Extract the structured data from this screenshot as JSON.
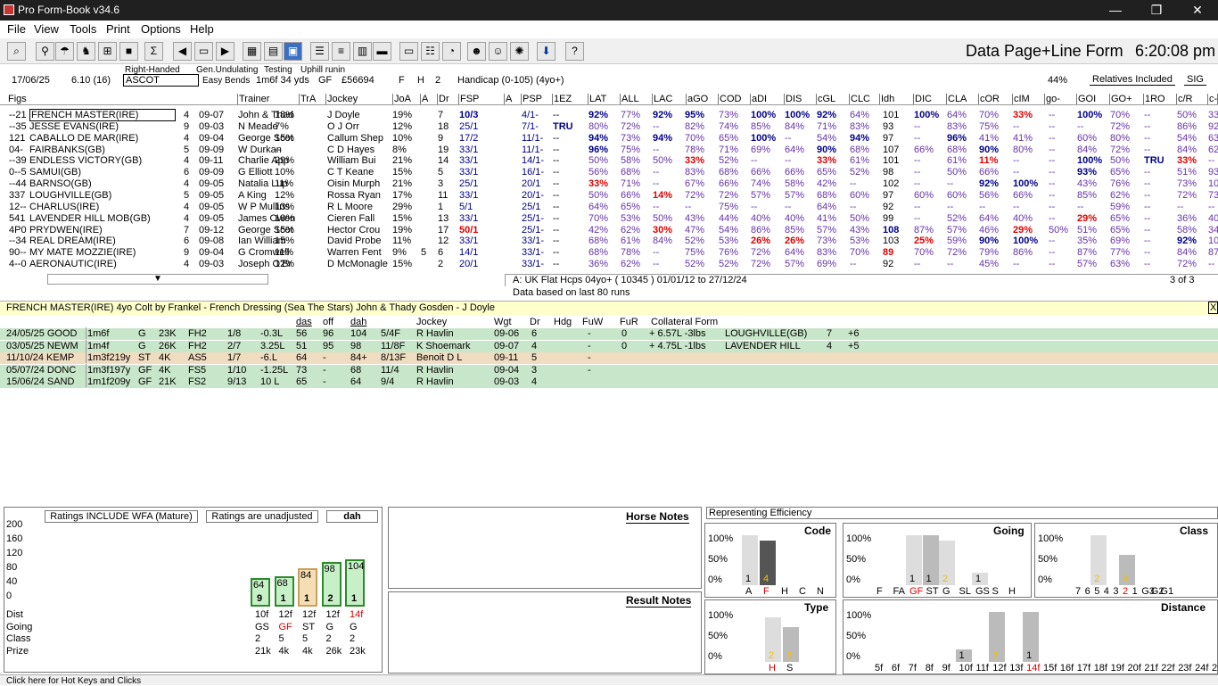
{
  "window": {
    "title": "Pro Form-Book v34.6",
    "min": "—",
    "max": "❐",
    "close": "✕"
  },
  "menu": [
    "File",
    "View",
    "Tools",
    "Print",
    "Options",
    "Help"
  ],
  "page_title": "Data Page+Line Form",
  "clock": "6:20:08 pm",
  "race": {
    "date": "17/06/25",
    "time": "6.10 (16)",
    "course": "ASCOT",
    "hand": "Right-Handed",
    "terrain1": "Gen.Undulating",
    "terrain2": "Easy Bends",
    "testing": "Testing",
    "uphill": "Uphill runin",
    "dist": "1m6f 34 yds",
    "going": "GF",
    "prize": "£56694",
    "f": "F",
    "h": "H",
    "n": "2",
    "type": "Handicap (0-105) (4yo+)",
    "pct": "44%",
    "relatives": "Relatives Included",
    "sig": "SIG"
  },
  "grid_headers": [
    "Figs",
    "Trainer",
    "TrA",
    "Jockey",
    "JoA",
    "A",
    "Dr",
    "FSP",
    "A",
    "PSP",
    "1EZ",
    "LAT",
    "ALL",
    "LAC",
    "aGO",
    "COD",
    "aDI",
    "DIS",
    "cGL",
    "CLC",
    "Idh",
    "DIC",
    "CLA",
    "cOR",
    "cIM",
    "go-",
    "GOI",
    "GO+",
    "1RO",
    "c/R",
    "c-"
  ],
  "runners": [
    [
      "--21",
      "FRENCH MASTER(IRE)",
      "4",
      "09-07",
      "John & Thad",
      "18%",
      "J Doyle",
      "19%",
      "",
      "7",
      "10/3",
      "4/1-",
      "--",
      "92%",
      "77%",
      "92%",
      "95%",
      "73%",
      "100%",
      "100%",
      "92%",
      "64%",
      "101",
      "100%",
      "64%",
      "70%",
      "33%",
      "--",
      "100%",
      "70%",
      "--",
      "50%",
      "33"
    ],
    [
      "--35",
      "JESSE EVANS(IRE)",
      "9",
      "09-03",
      "N Meade",
      "7%",
      "O J Orr",
      "12%",
      "",
      "18",
      "25/1",
      "7/1-",
      "TRU",
      "80%",
      "72%",
      "--",
      "82%",
      "74%",
      "85%",
      "84%",
      "71%",
      "83%",
      "93",
      "--",
      "83%",
      "75%",
      "--",
      "--",
      "--",
      "72%",
      "--",
      "86%",
      "92"
    ],
    [
      "121",
      "CABALLO DE MAR(IRE)",
      "4",
      "09-04",
      "George Scot",
      "15%",
      "Callum Shep",
      "10%",
      "",
      "9",
      "17/2",
      "11/1-",
      "--",
      "94%",
      "73%",
      "94%",
      "70%",
      "65%",
      "100%",
      "--",
      "54%",
      "94%",
      "97",
      "--",
      "96%",
      "41%",
      "41%",
      "--",
      "60%",
      "80%",
      "--",
      "54%",
      "63"
    ],
    [
      "04-",
      "FAIRBANKS(GB)",
      "5",
      "09-09",
      "W Durkan",
      "--",
      "C D Hayes",
      "8%",
      "",
      "19",
      "33/1",
      "11/1-",
      "--",
      "96%",
      "75%",
      "--",
      "78%",
      "71%",
      "69%",
      "64%",
      "90%",
      "68%",
      "107",
      "66%",
      "68%",
      "90%",
      "80%",
      "--",
      "84%",
      "72%",
      "--",
      "84%",
      "62"
    ],
    [
      "--39",
      "ENDLESS VICTORY(GB)",
      "4",
      "09-11",
      "Charlie App",
      "29%",
      "William Bui",
      "21%",
      "",
      "14",
      "33/1",
      "14/1-",
      "--",
      "50%",
      "58%",
      "50%",
      "33%",
      "52%",
      "--",
      "--",
      "33%",
      "61%",
      "101",
      "--",
      "61%",
      "11%",
      "--",
      "--",
      "100%",
      "50%",
      "TRU",
      "33%",
      "--"
    ],
    [
      "0--5",
      "SAMUI(GB)",
      "6",
      "09-09",
      "G Elliott",
      "10%",
      "C T Keane",
      "15%",
      "",
      "5",
      "33/1",
      "16/1-",
      "--",
      "56%",
      "68%",
      "--",
      "83%",
      "68%",
      "66%",
      "66%",
      "65%",
      "52%",
      "98",
      "--",
      "50%",
      "66%",
      "--",
      "--",
      "93%",
      "65%",
      "--",
      "51%",
      "93"
    ],
    [
      "--44",
      "BARNSO(GB)",
      "4",
      "09-05",
      "Natalia Lup",
      "11%",
      "Oisin Murph",
      "21%",
      "",
      "3",
      "25/1",
      "20/1",
      "--",
      "33%",
      "71%",
      "--",
      "67%",
      "66%",
      "74%",
      "58%",
      "42%",
      "--",
      "102",
      "--",
      "--",
      "92%",
      "100%",
      "--",
      "43%",
      "76%",
      "--",
      "73%",
      "10"
    ],
    [
      "337",
      "LOUGHVILLE(GB)",
      "5",
      "09-05",
      "A King",
      "12%",
      "Rossa Ryan",
      "17%",
      "",
      "11",
      "33/1",
      "20/1-",
      "--",
      "50%",
      "66%",
      "14%",
      "72%",
      "72%",
      "57%",
      "57%",
      "68%",
      "60%",
      "97",
      "60%",
      "60%",
      "56%",
      "66%",
      "--",
      "85%",
      "62%",
      "--",
      "72%",
      "73"
    ],
    [
      "12--",
      "CHARLUS(IRE)",
      "4",
      "09-05",
      "W P Mullins",
      "13%",
      "R L Moore",
      "29%",
      "",
      "1",
      "5/1",
      "25/1",
      "--",
      "64%",
      "65%",
      "--",
      "--",
      "75%",
      "--",
      "--",
      "64%",
      "--",
      "92",
      "--",
      "--",
      "--",
      "--",
      "--",
      "--",
      "59%",
      "--",
      "--",
      "--"
    ],
    [
      "541",
      "LAVENDER HILL MOB(GB)",
      "4",
      "09-05",
      "James Owen",
      "18%",
      "Cieren Fall",
      "15%",
      "",
      "13",
      "33/1",
      "25/1-",
      "--",
      "70%",
      "53%",
      "50%",
      "43%",
      "44%",
      "40%",
      "40%",
      "41%",
      "50%",
      "99",
      "--",
      "52%",
      "64%",
      "40%",
      "--",
      "29%",
      "65%",
      "--",
      "36%",
      "40"
    ],
    [
      "4P0",
      "PRYDWEN(IRE)",
      "7",
      "09-12",
      "George Scot",
      "15%",
      "Hector Crou",
      "19%",
      "",
      "17",
      "50/1",
      "25/1-",
      "--",
      "42%",
      "62%",
      "30%",
      "47%",
      "54%",
      "86%",
      "85%",
      "57%",
      "43%",
      "108",
      "87%",
      "57%",
      "46%",
      "29%",
      "50%",
      "51%",
      "65%",
      "--",
      "58%",
      "34"
    ],
    [
      "--34",
      "REAL DREAM(IRE)",
      "6",
      "09-08",
      "Ian William",
      "15%",
      "David Probe",
      "11%",
      "",
      "12",
      "33/1",
      "33/1-",
      "--",
      "68%",
      "61%",
      "84%",
      "52%",
      "53%",
      "26%",
      "26%",
      "73%",
      "53%",
      "103",
      "25%",
      "59%",
      "90%",
      "100%",
      "--",
      "35%",
      "69%",
      "--",
      "92%",
      "10"
    ],
    [
      "90--",
      "MY MATE MOZZIE(IRE)",
      "9",
      "09-04",
      "G Cromwell",
      "11%",
      "Warren Fent",
      "9%",
      "5",
      "6",
      "14/1",
      "33/1-",
      "--",
      "68%",
      "78%",
      "--",
      "75%",
      "76%",
      "72%",
      "64%",
      "83%",
      "70%",
      "89",
      "70%",
      "72%",
      "79%",
      "86%",
      "--",
      "87%",
      "77%",
      "--",
      "84%",
      "87"
    ],
    [
      "4--0",
      "AERONAUTIC(IRE)",
      "4",
      "09-03",
      "Joseph O'Br",
      "12%",
      "D McMonagle",
      "15%",
      "",
      "2",
      "20/1",
      "33/1-",
      "--",
      "36%",
      "62%",
      "--",
      "52%",
      "52%",
      "72%",
      "57%",
      "69%",
      "--",
      "92",
      "--",
      "--",
      "45%",
      "--",
      "--",
      "57%",
      "63%",
      "--",
      "72%",
      "--"
    ]
  ],
  "grid_footer": {
    "filter": "A: UK Flat Hcps 04yo+ ( 10345 )   01/01/12 to 27/12/24",
    "page": "3  of  3",
    "note": "Data based on last 80 runs"
  },
  "info": {
    "text": "FRENCH MASTER(IRE)   4yo Colt by Frankel - French Dressing (Sea The Stars)   John & Thady Gosden  -  J Doyle",
    "close": "X"
  },
  "form_headers": [
    "das",
    "off",
    "dah",
    "Jockey",
    "Wgt",
    "Dr",
    "Hdg",
    "FuW",
    "FuR",
    "Collateral Form"
  ],
  "form": [
    {
      "date": "24/05/25 GOOD",
      "dist": "1m6f",
      "g": "G",
      "prize": "23K",
      "cls": "FH2",
      "pos": "1/8",
      "btn": "-0.3L",
      "das": "56",
      "off": "96",
      "dah": "104",
      "sp": "5/4F",
      "jockey": "R Havlin",
      "wgt": "09-06",
      "dr": "6",
      "fuw": "-",
      "fur": "0",
      "coll": "+ 6.57L  -3lbs",
      "ch": "LOUGHVILLE(GB)",
      "cn": "7",
      "cv": "+6"
    },
    {
      "date": "03/05/25 NEWM",
      "dist": "1m4f",
      "g": "G",
      "prize": "26K",
      "cls": "FH2",
      "pos": "2/7",
      "btn": "3.25L",
      "das": "51",
      "off": "95",
      "dah": "98",
      "sp": "11/8F",
      "jockey": "K Shoemark",
      "wgt": "09-07",
      "dr": "4",
      "fuw": "-",
      "fur": "0",
      "coll": "+ 4.75L  -1lbs",
      "ch": "LAVENDER HILL",
      "cn": "4",
      "cv": "+5"
    },
    {
      "date": "11/10/24 KEMP",
      "dist": "1m3f219y",
      "g": "ST",
      "prize": "4K",
      "cls": "AS5",
      "pos": "1/7",
      "btn": "-6.L",
      "das": "64",
      "off": "-",
      "dah": "84+",
      "sp": "8/13F",
      "jockey": "Benoit D L",
      "wgt": "09-11",
      "dr": "5",
      "fuw": "-",
      "fur": "",
      "coll": "",
      "ch": "",
      "cn": "",
      "cv": ""
    },
    {
      "date": "05/07/24 DONC",
      "dist": "1m3f197y",
      "g": "GF",
      "prize": "4K",
      "cls": "FS5",
      "pos": "1/10",
      "btn": "-1.25L",
      "das": "73",
      "off": "-",
      "dah": "68",
      "sp": "11/4",
      "jockey": "R Havlin",
      "wgt": "09-04",
      "dr": "3",
      "fuw": "-",
      "fur": "",
      "coll": "",
      "ch": "",
      "cn": "",
      "cv": ""
    },
    {
      "date": "15/06/24 SAND",
      "dist": "1m1f209y",
      "g": "GF",
      "prize": "21K",
      "cls": "FS2",
      "pos": "9/13",
      "btn": "10 L",
      "das": "65",
      "off": "-",
      "dah": "64",
      "sp": "9/4",
      "jockey": "R Havlin",
      "wgt": "09-03",
      "dr": "4",
      "fuw": "",
      "fur": "",
      "coll": "",
      "ch": "",
      "cn": "",
      "cv": ""
    }
  ],
  "ratings": {
    "btn1": "Ratings INCLUDE WFA (Mature)",
    "btn2": "Ratings are unadjusted",
    "btn3": "dah",
    "axis": [
      "200",
      "160",
      "120",
      "80",
      "40",
      "0"
    ],
    "rows": [
      "Dist",
      "Going",
      "Class",
      "Prize"
    ],
    "bars": [
      {
        "val": 64,
        "pos": "9",
        "dist": "10f",
        "going": "GS",
        "cls": "2",
        "prize": "21k"
      },
      {
        "val": 68,
        "pos": "1",
        "dist": "12f",
        "going": "GF",
        "cls": "5",
        "prize": "4k"
      },
      {
        "val": 84,
        "pos": "1",
        "dist": "12f",
        "going": "ST",
        "cls": "5",
        "prize": "4k"
      },
      {
        "val": 98,
        "pos": "2",
        "dist": "12f",
        "going": "G",
        "cls": "2",
        "prize": "26k"
      },
      {
        "val": 104,
        "pos": "1",
        "dist": "14f",
        "going": "G",
        "cls": "2",
        "prize": "23k"
      }
    ]
  },
  "notes": {
    "horse": "Horse Notes",
    "result": "Result Notes"
  },
  "eff": {
    "title": "Representing Efficiency",
    "ticks": [
      "100%",
      "50%",
      "0%"
    ],
    "code": {
      "title": "Code",
      "labels": [
        "A",
        "F",
        "H",
        "C",
        "N"
      ],
      "vals": [
        100,
        90,
        0,
        0,
        0
      ],
      "counts": [
        "1",
        "4",
        "",
        "",
        ""
      ]
    },
    "going": {
      "title": "Going",
      "labels": [
        "F",
        "FA",
        "GF",
        "ST",
        "G",
        "SL",
        "GS",
        "S",
        "H"
      ],
      "vals": [
        0,
        0,
        100,
        100,
        90,
        0,
        25,
        0,
        0
      ],
      "counts": [
        "",
        "",
        "1",
        "1",
        "2",
        "",
        "1",
        "",
        ""
      ]
    },
    "class": {
      "title": "Class",
      "labels": [
        "7",
        "6",
        "5",
        "4",
        "3",
        "2",
        "1",
        "G3",
        "G2",
        "G1"
      ],
      "vals": [
        0,
        0,
        100,
        0,
        0,
        60,
        0,
        0,
        0,
        0
      ],
      "counts": [
        "",
        "",
        "2",
        "",
        "",
        "3",
        "",
        "",
        "",
        ""
      ]
    },
    "type": {
      "title": "Type",
      "labels": [
        "H",
        "S"
      ],
      "vals": [
        90,
        70
      ],
      "counts": [
        "2",
        "3"
      ]
    },
    "distance": {
      "title": "Distance",
      "labels": [
        "5f",
        "6f",
        "7f",
        "8f",
        "9f",
        "10f",
        "11f",
        "12f",
        "13f",
        "14f",
        "15f",
        "16f",
        "17f",
        "18f",
        "19f",
        "20f",
        "21f",
        "22f",
        "23f",
        "24f",
        "25f",
        "26f"
      ],
      "vals": [
        0,
        0,
        0,
        0,
        0,
        25,
        0,
        100,
        0,
        100,
        0,
        0,
        0,
        0,
        0,
        0,
        0,
        0,
        0,
        0,
        0,
        0
      ],
      "counts": [
        "",
        "",
        "",
        "",
        "",
        "1",
        "",
        "3",
        "",
        "1",
        "",
        "",
        "",
        "",
        "",
        "",
        "",
        "",
        "",
        "",
        "",
        ""
      ]
    }
  },
  "status": "Click here for Hot Keys and Clicks"
}
